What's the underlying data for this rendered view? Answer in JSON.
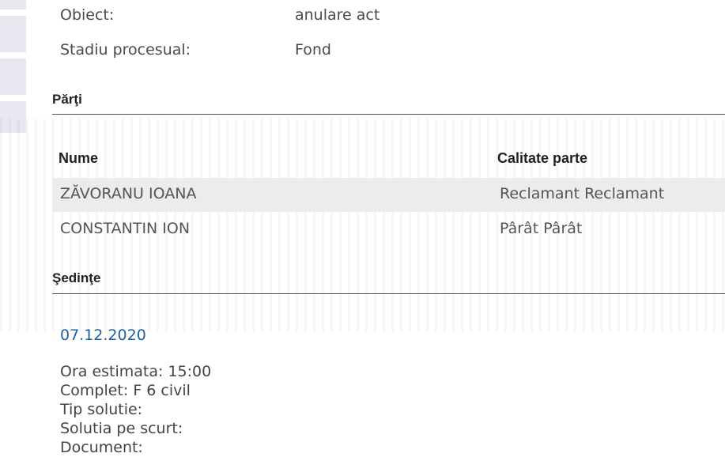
{
  "case": {
    "obiect_label": "Obiect:",
    "obiect_value": "anulare act",
    "stadiu_label": "Stadiu procesual:",
    "stadiu_value": "Fond"
  },
  "parti": {
    "title": "Părţi",
    "col_nume": "Nume",
    "col_calitate": "Calitate parte",
    "rows": [
      {
        "nume": "ZĂVORANU IOANA",
        "calitate": "Reclamant Reclamant"
      },
      {
        "nume": "CONSTANTIN ION",
        "calitate": "Pârât Pârât"
      }
    ]
  },
  "sedinte": {
    "title": "Şedinţe",
    "date": "07.12.2020",
    "ora": "Ora estimata: 15:00",
    "complet": "Complet: F 6 civil",
    "tip_solutie": "Tip solutie:",
    "solutia": "Solutia pe scurt:",
    "document": "Document:"
  },
  "colors": {
    "link": "#1f5f9e",
    "row_alt": "#ececec",
    "sidebar": "#e6e7ef"
  }
}
